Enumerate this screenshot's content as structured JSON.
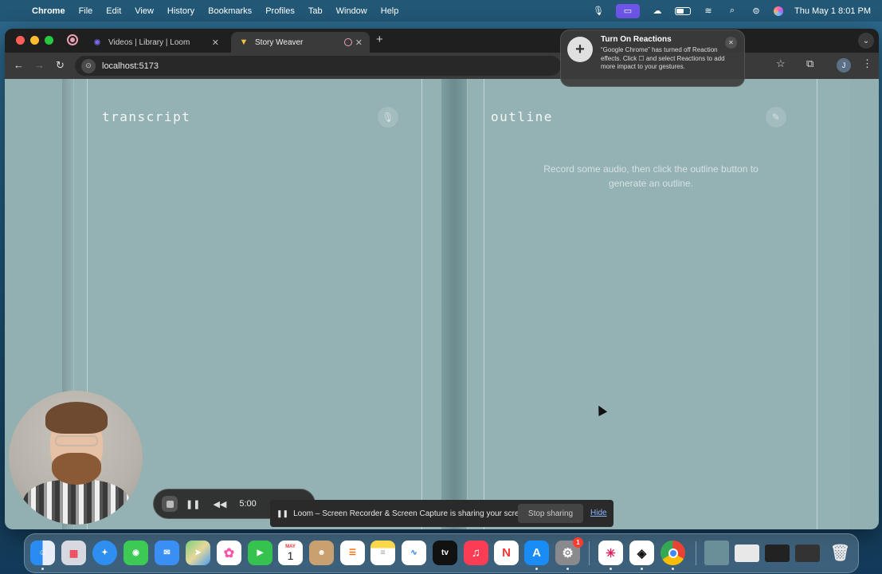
{
  "menubar": {
    "app_name": "Chrome",
    "items": [
      "File",
      "Edit",
      "View",
      "History",
      "Bookmarks",
      "Profiles",
      "Tab",
      "Window",
      "Help"
    ],
    "clock": "Thu May 1  8:01 PM"
  },
  "browser": {
    "tabs": [
      {
        "title": "Videos | Library | Loom"
      },
      {
        "title": "Story Weaver"
      }
    ],
    "url": "localhost:5173",
    "profile_initial": "J"
  },
  "notification": {
    "title": "Turn On Reactions",
    "body": "“Google Chrome” has turned off Reaction effects. Click ☐ and select Reactions to add more impact to your gestures."
  },
  "app": {
    "transcript_title": "transcript",
    "outline_title": "outline",
    "outline_placeholder": "Record some audio, then click the outline button to generate an outline."
  },
  "recorder": {
    "time": "5:00"
  },
  "sharing": {
    "message": "Loom – Screen Recorder & Screen Capture is sharing your screen.",
    "stop_label": "Stop sharing",
    "hide_label": "Hide"
  },
  "dock": {
    "calendar_month": "MAY",
    "calendar_day": "1",
    "settings_badge": "1",
    "apps": [
      "finder-icon",
      "launchpad-icon",
      "safari-icon",
      "messages-icon",
      "mail-icon",
      "maps-icon",
      "photos-icon",
      "facetime-icon",
      "calendar-icon",
      "contacts-icon",
      "reminders-icon",
      "notes-icon",
      "freeform-icon",
      "appletv-icon",
      "music-icon",
      "news-icon",
      "appstore-icon",
      "settings-icon",
      "slack-icon",
      "unity-icon",
      "chrome-icon"
    ],
    "appletv_label": "tv"
  },
  "colors": {
    "page_bg": "#92afb1",
    "recording_accent": "#6d55e8",
    "stop_red": "#ff3b30"
  }
}
